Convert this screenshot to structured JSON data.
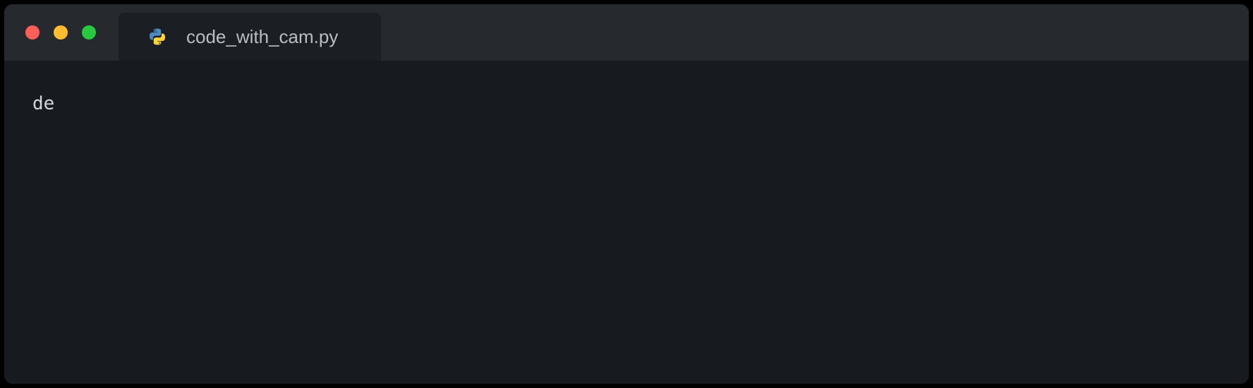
{
  "window": {
    "controls": {
      "close_color": "#ff5f57",
      "minimize_color": "#febc2e",
      "maximize_color": "#28c840"
    },
    "tab": {
      "icon": "python-icon",
      "filename": "code_with_cam.py"
    }
  },
  "editor": {
    "lines": [
      "de"
    ]
  }
}
